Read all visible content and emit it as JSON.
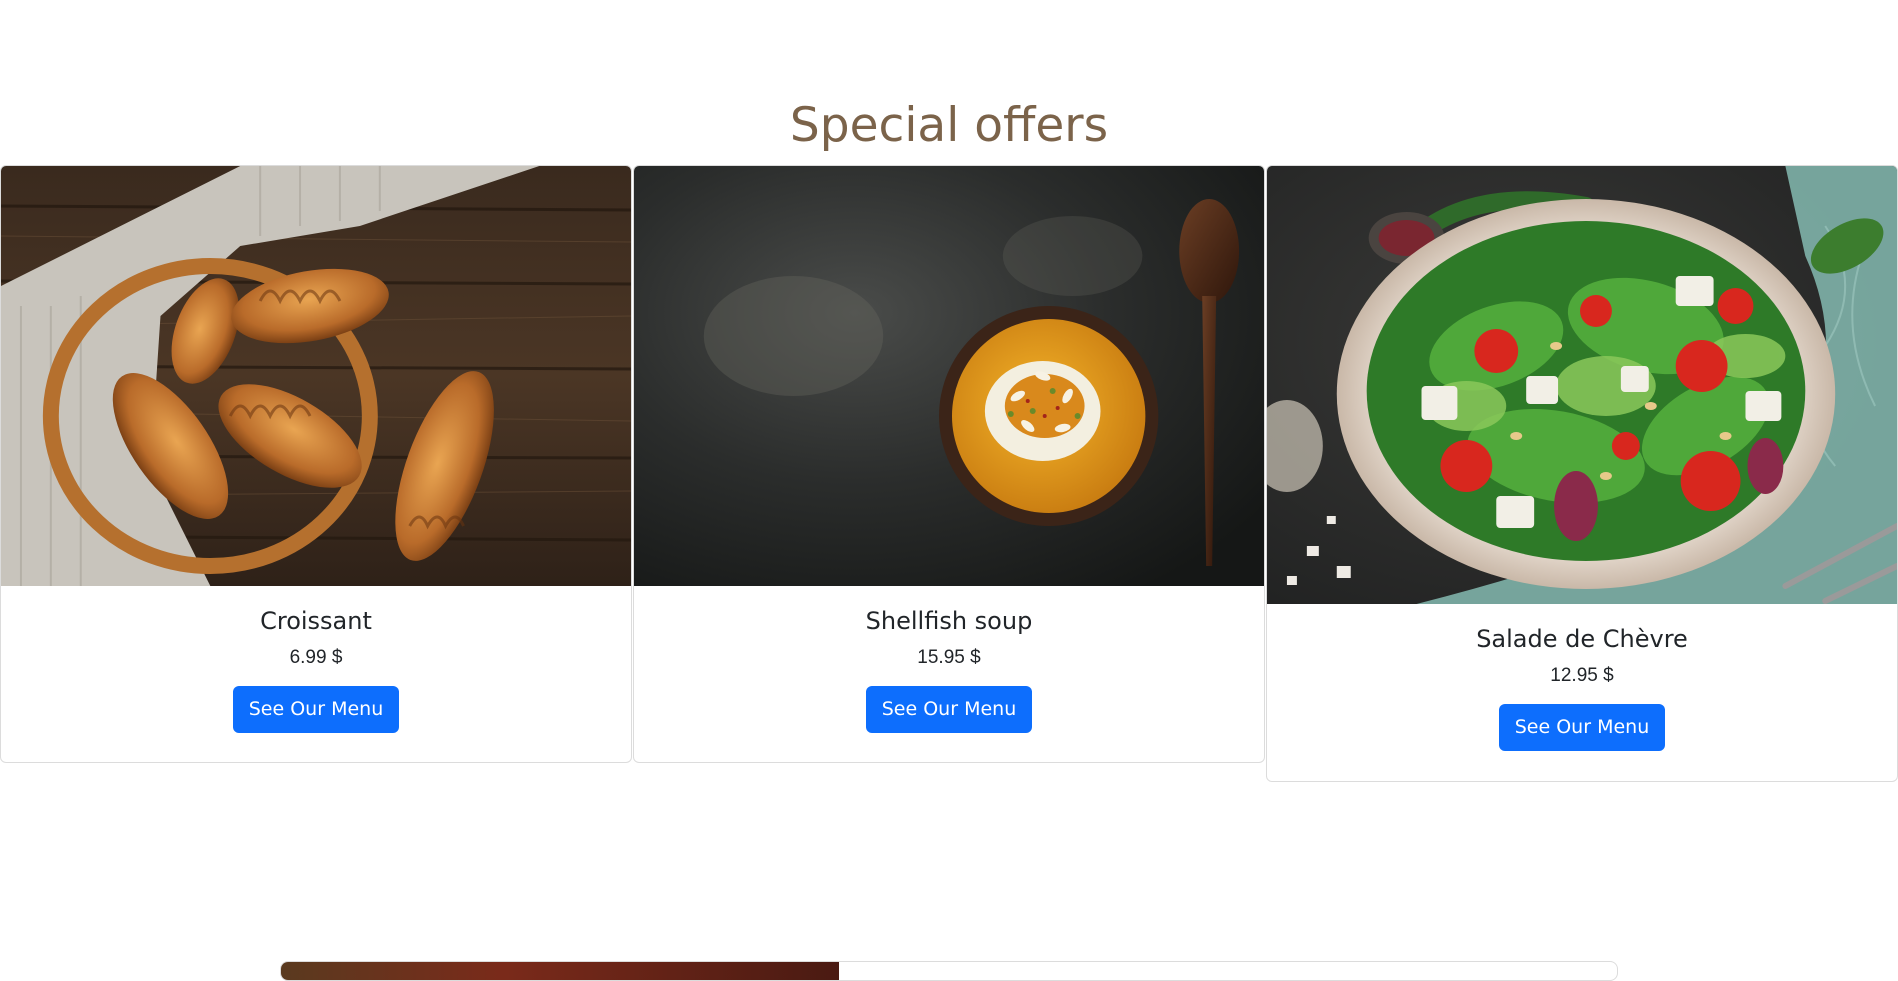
{
  "section": {
    "title": "Special offers"
  },
  "offers": [
    {
      "name": "Croissant",
      "price": "6.99 $",
      "button_label": "See Our Menu",
      "image": "croissant-basket-photo"
    },
    {
      "name": "Shellfish soup",
      "price": "15.95 $",
      "button_label": "See Our Menu",
      "image": "soup-bowl-photo"
    },
    {
      "name": "Salade de Chèvre",
      "price": "12.95 $",
      "button_label": "See Our Menu",
      "image": "salad-bowl-photo"
    }
  ],
  "colors": {
    "title": "#7b634a",
    "button": "#0d6efd",
    "card_border": "#dcdcdc"
  }
}
